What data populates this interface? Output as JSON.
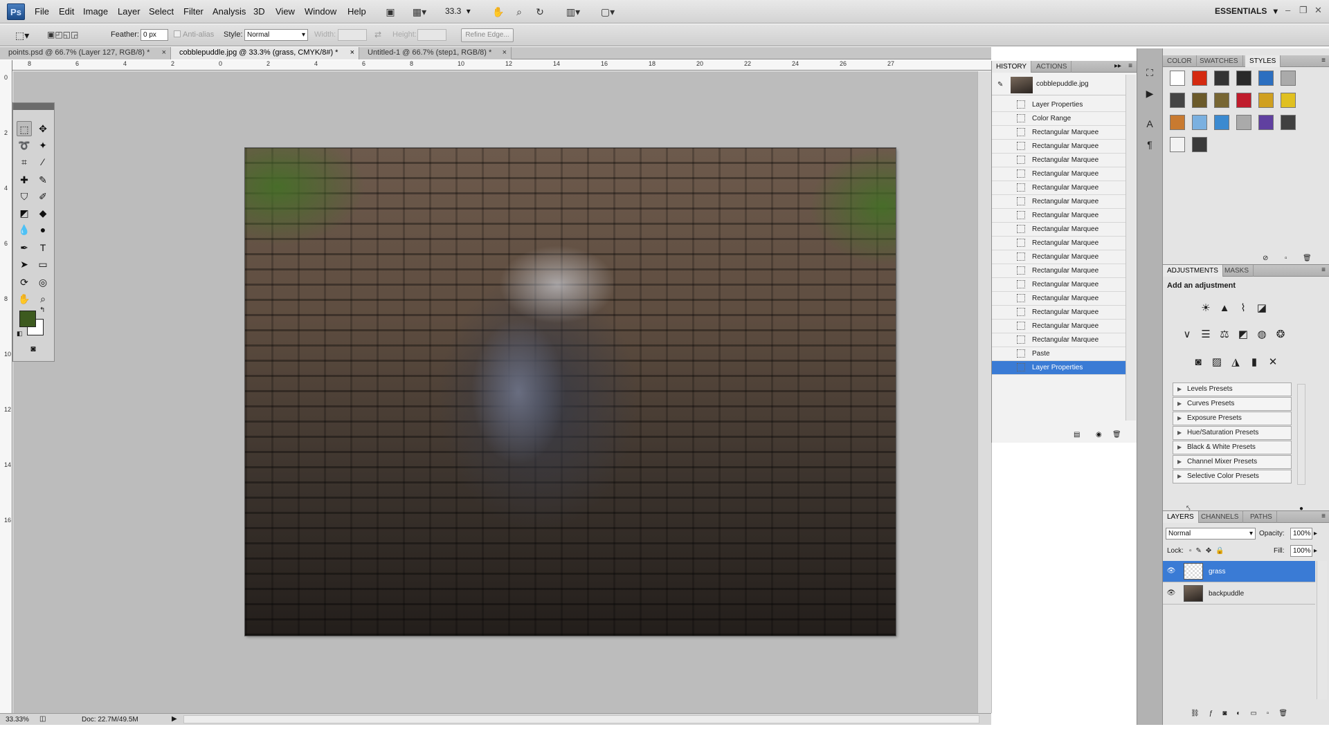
{
  "app": {
    "logo_text": "Ps",
    "menus": [
      "File",
      "Edit",
      "Image",
      "Layer",
      "Select",
      "Filter",
      "Analysis",
      "3D",
      "View",
      "Window",
      "Help"
    ],
    "zoom": "33.3",
    "workspace": "ESSENTIALS"
  },
  "options": {
    "feather_label": "Feather:",
    "feather_value": "0 px",
    "antialias_label": "Anti-alias",
    "style_label": "Style:",
    "style_value": "Normal",
    "width_label": "Width:",
    "height_label": "Height:",
    "refine_edge": "Refine Edge..."
  },
  "tabs": [
    {
      "label": "points.psd @ 66.7% (Layer 127, RGB/8) *",
      "close": "×"
    },
    {
      "label": "cobblepuddle.jpg @ 33.3% (grass, CMYK/8#) *",
      "close": "×"
    },
    {
      "label": "Untitled-1 @ 66.7% (step1, RGB/8) *",
      "close": "×"
    }
  ],
  "ruler": {
    "h_ticks": [
      "8",
      "6",
      "4",
      "2",
      "0",
      "2",
      "4",
      "6",
      "8",
      "10",
      "12",
      "14",
      "16",
      "18",
      "20",
      "22",
      "24",
      "26",
      "27"
    ],
    "v_ticks": [
      "0",
      "2",
      "4",
      "6",
      "8",
      "10",
      "12",
      "14",
      "16"
    ]
  },
  "status": {
    "zoom": "33.33%",
    "doc": "Doc: 22.7M/49.5M"
  },
  "history": {
    "tabs": [
      "HISTORY",
      "ACTIONS"
    ],
    "snapshot": "cobblepuddle.jpg",
    "items": [
      "Layer Properties",
      "Color Range",
      "Rectangular Marquee",
      "Rectangular Marquee",
      "Rectangular Marquee",
      "Rectangular Marquee",
      "Rectangular Marquee",
      "Rectangular Marquee",
      "Rectangular Marquee",
      "Rectangular Marquee",
      "Rectangular Marquee",
      "Rectangular Marquee",
      "Rectangular Marquee",
      "Rectangular Marquee",
      "Rectangular Marquee",
      "Rectangular Marquee",
      "Rectangular Marquee",
      "Rectangular Marquee",
      "Paste",
      "Layer Properties"
    ],
    "selected_index": 19
  },
  "color_panel": {
    "tabs": [
      "COLOR",
      "SWATCHES",
      "STYLES"
    ],
    "style_colors": [
      "#ffffff",
      "#d42a10",
      "#333333",
      "#2a2a2a",
      "#2c6fc0",
      "#aaaaaa",
      "#444444",
      "#6b5a2a",
      "#776633",
      "#c01c2c",
      "#d0a020",
      "#e0c020",
      "#c87a30",
      "#7ab0e0",
      "#3b8ad0",
      "#aaaaaa",
      "#6040a0",
      "#404040",
      "#f2f2f2",
      "#3a3a3a"
    ]
  },
  "adjustments": {
    "tabs": [
      "ADJUSTMENTS",
      "MASKS"
    ],
    "heading": "Add an adjustment",
    "presets": [
      "Levels Presets",
      "Curves Presets",
      "Exposure Presets",
      "Hue/Saturation Presets",
      "Black & White Presets",
      "Channel Mixer Presets",
      "Selective Color Presets"
    ]
  },
  "layers": {
    "tabs": [
      "LAYERS",
      "CHANNELS",
      "PATHS"
    ],
    "blend_mode": "Normal",
    "opacity_label": "Opacity:",
    "opacity": "100%",
    "lock_label": "Lock:",
    "fill_label": "Fill:",
    "fill": "100%",
    "items": [
      {
        "name": "grass"
      },
      {
        "name": "backpuddle"
      }
    ],
    "selected_index": 0
  },
  "colors": {
    "accent": "#3a7bd5",
    "foreground": "#3d5a1f",
    "background": "#ffffff"
  }
}
